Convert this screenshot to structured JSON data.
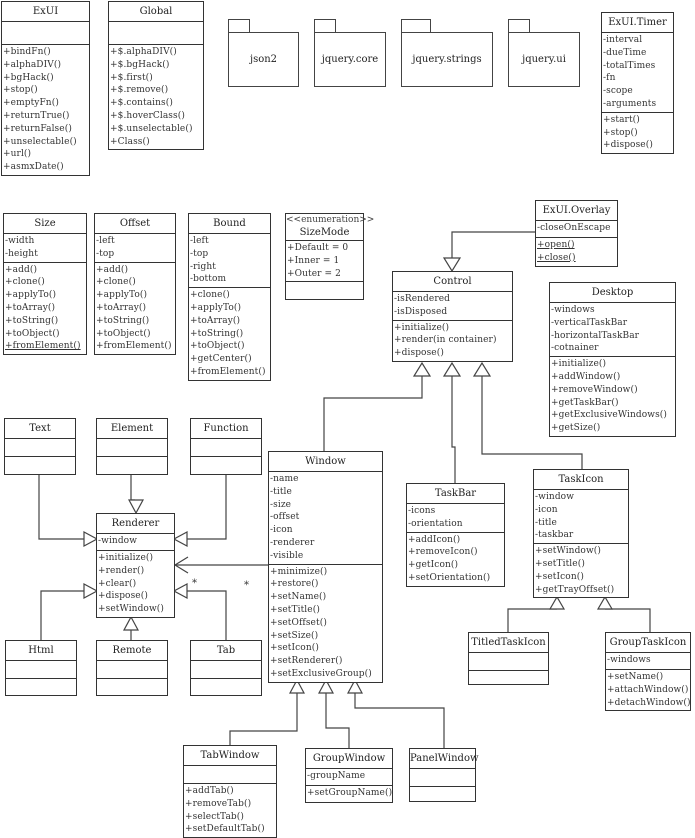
{
  "diagram": {
    "type": "uml-class-diagram",
    "packages": [
      "json2",
      "jquery.core",
      "jquery.strings",
      "jquery.ui"
    ],
    "classes": {
      "exui": {
        "name": "ExUI",
        "attributes": [],
        "methods": [
          "+bindFn()",
          "+alphaDIV()",
          "+bgHack()",
          "+stop()",
          "+emptyFn()",
          "+returnTrue()",
          "+returnFalse()",
          "+unselectable()",
          "+url()",
          "+asmxDate()"
        ]
      },
      "global": {
        "name": "Global",
        "attributes": [],
        "methods": [
          "+$.alphaDIV()",
          "+$.bgHack()",
          "+$.first()",
          "+$.remove()",
          "+$.contains()",
          "+$.hoverClass()",
          "+$.unselectable()",
          "+Class()"
        ]
      },
      "timer": {
        "name": "ExUI.Timer",
        "attributes": [
          "-interval",
          "-dueTime",
          "-totalTimes",
          "-fn",
          "-scope",
          "-arguments"
        ],
        "methods": [
          "+start()",
          "+stop()",
          "+dispose()"
        ]
      },
      "size": {
        "name": "Size",
        "attributes": [
          "-width",
          "-height"
        ],
        "methods": [
          "+add()",
          "+clone()",
          "+applyTo()",
          "+toArray()",
          "+toString()",
          "+toObject()"
        ],
        "static_methods": [
          "+fromElement()"
        ]
      },
      "offset": {
        "name": "Offset",
        "attributes": [
          "-left",
          "-top"
        ],
        "methods": [
          "+add()",
          "+clone()",
          "+applyTo()",
          "+toArray()",
          "+toString()",
          "+toObject()",
          "+fromElement()"
        ]
      },
      "bound": {
        "name": "Bound",
        "attributes": [
          "-left",
          "-top",
          "-right",
          "-bottom"
        ],
        "methods": [
          "+clone()",
          "+applyTo()",
          "+toArray()",
          "+toString()",
          "+toObject()",
          "+getCenter()",
          "+fromElement()"
        ]
      },
      "sizemode": {
        "stereotype": "<<enumeration>>",
        "name": "SizeMode",
        "attributes": [
          "+Default = 0",
          "+Inner = 1",
          "+Outer = 2"
        ],
        "methods": []
      },
      "overlay": {
        "name": "ExUI.Overlay",
        "attributes": [
          "-closeOnEscape"
        ],
        "static_methods": [
          "+open()",
          "+close()"
        ]
      },
      "control": {
        "name": "Control",
        "attributes": [
          "-isRendered",
          "-isDisposed"
        ],
        "methods": [
          "+initialize()",
          "+render(in container)",
          "+dispose()"
        ]
      },
      "desktop": {
        "name": "Desktop",
        "attributes": [
          "-windows",
          "-verticalTaskBar",
          "-horizontalTaskBar",
          "-cotnainer"
        ],
        "methods": [
          "+initialize()",
          "+addWindow()",
          "+removeWindow()",
          "+getTaskBar()",
          "+getExclusiveWindows()",
          "+getSize()"
        ]
      },
      "text": {
        "name": "Text",
        "attributes": [],
        "methods": []
      },
      "element": {
        "name": "Element",
        "attributes": [],
        "methods": []
      },
      "function": {
        "name": "Function",
        "attributes": [],
        "methods": []
      },
      "renderer": {
        "name": "Renderer",
        "attributes": [
          "-window"
        ],
        "methods": [
          "+initialize()",
          "+render()",
          "+clear()",
          "+dispose()",
          "+setWindow()"
        ]
      },
      "html": {
        "name": "Html",
        "attributes": [],
        "methods": []
      },
      "remote": {
        "name": "Remote",
        "attributes": [],
        "methods": []
      },
      "tab": {
        "name": "Tab",
        "attributes": [],
        "methods": []
      },
      "window": {
        "name": "Window",
        "attributes": [
          "-name",
          "-title",
          "-size",
          "-offset",
          "-icon",
          "-renderer",
          "-visible"
        ],
        "methods": [
          "+minimize()",
          "+restore()",
          "+setName()",
          "+setTitle()",
          "+setOffset()",
          "+setSize()",
          "+setIcon()",
          "+setRenderer()",
          "+setExclusiveGroup()"
        ]
      },
      "taskbar": {
        "name": "TaskBar",
        "attributes": [
          "-icons",
          "-orientation"
        ],
        "methods": [
          "+addIcon()",
          "+removeIcon()",
          "+getIcon()",
          "+setOrientation()"
        ]
      },
      "taskicon": {
        "name": "TaskIcon",
        "attributes": [
          "-window",
          "-icon",
          "-title",
          "-taskbar"
        ],
        "methods": [
          "+setWindow()",
          "+setTitle()",
          "+setIcon()",
          "+getTrayOffset()"
        ]
      },
      "titledtaskicon": {
        "name": "TitledTaskIcon",
        "attributes": [],
        "methods": []
      },
      "grouptaskicon": {
        "name": "GroupTaskIcon",
        "attributes": [
          "-windows"
        ],
        "methods": [
          "+setName()",
          "+attachWindow()",
          "+detachWindow()"
        ]
      },
      "tabwindow": {
        "name": "TabWindow",
        "attributes": [],
        "methods": [
          "+addTab()",
          "+removeTab()",
          "+selectTab()",
          "+setDefaultTab()"
        ]
      },
      "groupwindow": {
        "name": "GroupWindow",
        "attributes": [
          "-groupName"
        ],
        "methods": [
          "+setGroupName()"
        ]
      },
      "panelwindow": {
        "name": "PanelWindow",
        "attributes": [],
        "methods": []
      }
    },
    "relations": [
      {
        "from": "ExUI.Overlay",
        "to": "Control",
        "kind": "generalization"
      },
      {
        "from": "Window",
        "to": "Control",
        "kind": "generalization"
      },
      {
        "from": "TaskBar",
        "to": "Control",
        "kind": "generalization"
      },
      {
        "from": "TaskIcon",
        "to": "Control",
        "kind": "generalization"
      },
      {
        "from": "Text",
        "to": "Renderer",
        "kind": "generalization"
      },
      {
        "from": "Element",
        "to": "Renderer",
        "kind": "generalization"
      },
      {
        "from": "Function",
        "to": "Renderer",
        "kind": "generalization"
      },
      {
        "from": "Html",
        "to": "Renderer",
        "kind": "generalization"
      },
      {
        "from": "Remote",
        "to": "Renderer",
        "kind": "generalization"
      },
      {
        "from": "Tab",
        "to": "Renderer",
        "kind": "generalization"
      },
      {
        "from": "Window",
        "to": "Renderer",
        "kind": "association"
      },
      {
        "from": "TitledTaskIcon",
        "to": "TaskIcon",
        "kind": "generalization"
      },
      {
        "from": "GroupTaskIcon",
        "to": "TaskIcon",
        "kind": "generalization"
      },
      {
        "from": "TabWindow",
        "to": "Window",
        "kind": "generalization"
      },
      {
        "from": "GroupWindow",
        "to": "Window",
        "kind": "generalization"
      },
      {
        "from": "PanelWindow",
        "to": "Window",
        "kind": "generalization"
      }
    ],
    "multiplicities": [
      "*",
      "*"
    ]
  }
}
